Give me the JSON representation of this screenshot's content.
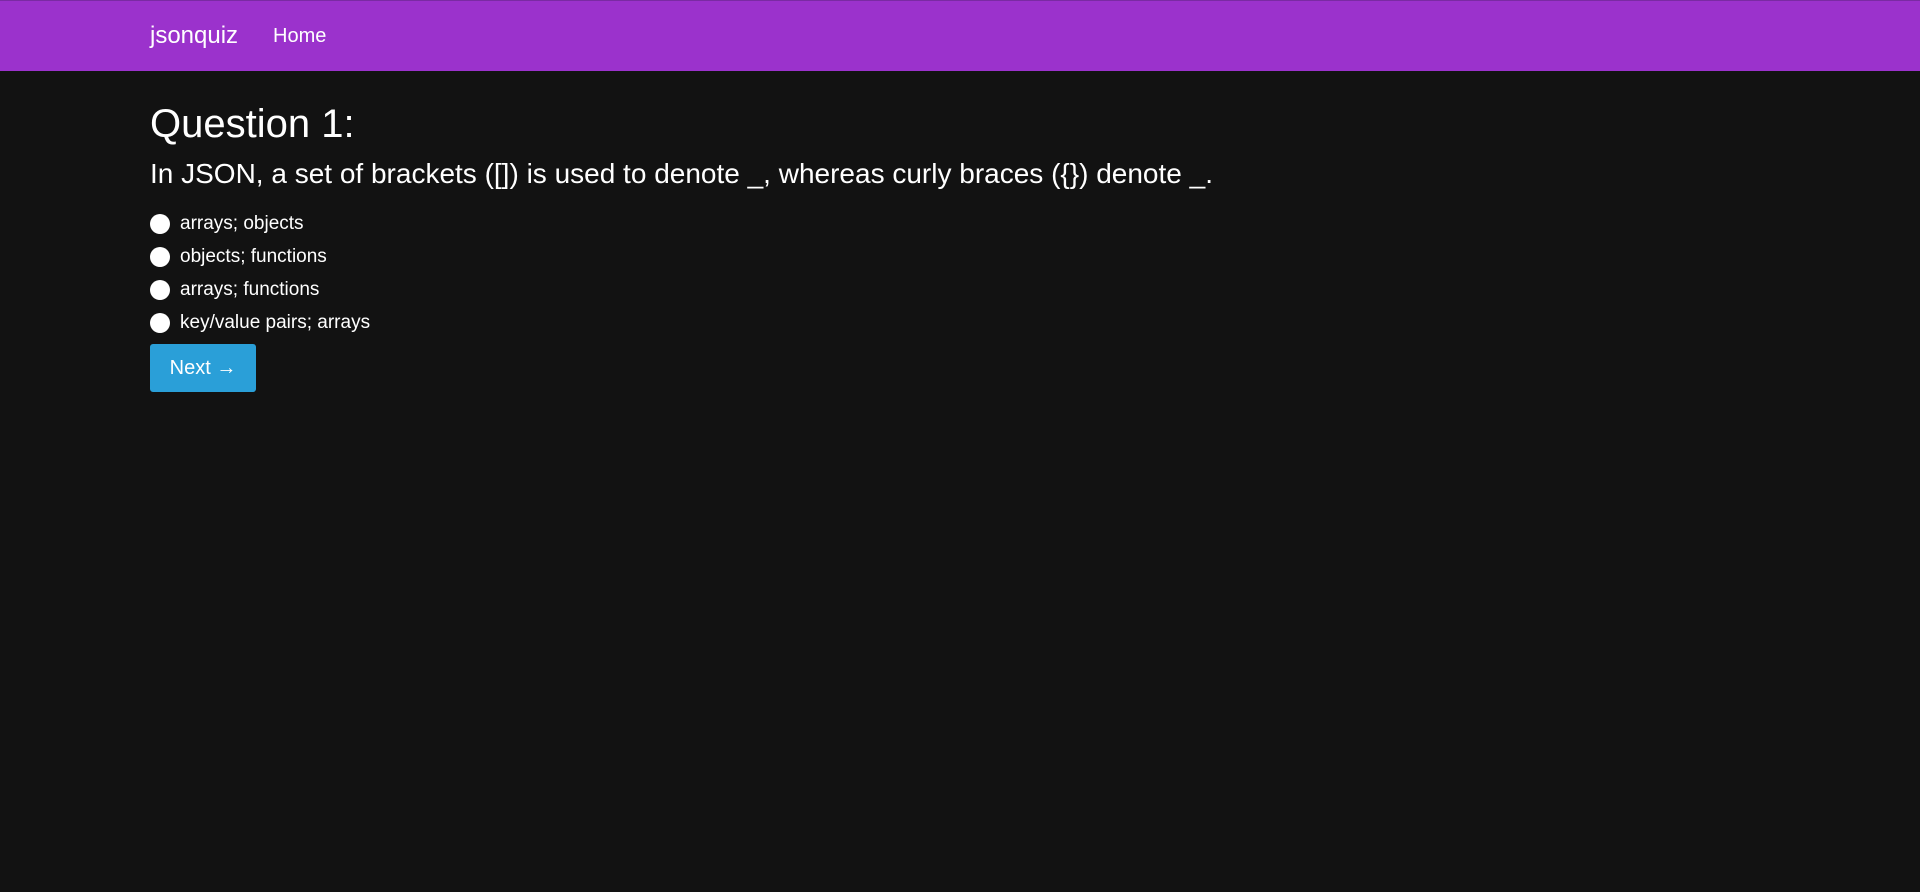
{
  "navbar": {
    "brand": "jsonquiz",
    "links": [
      {
        "label": "Home"
      }
    ],
    "color": "#9b32cc"
  },
  "quiz": {
    "question_title": "Question 1:",
    "question_text": "In JSON, a set of brackets ([]) is used to denote _, whereas curly braces ({}) denote _.",
    "options": [
      {
        "label": "arrays; objects",
        "selected": false
      },
      {
        "label": "objects; functions",
        "selected": false
      },
      {
        "label": "arrays; functions",
        "selected": false
      },
      {
        "label": "key/value pairs; arrays",
        "selected": false
      }
    ],
    "next_label": "Next →",
    "next_color": "#2a9fd8"
  },
  "background_color": "#121212"
}
